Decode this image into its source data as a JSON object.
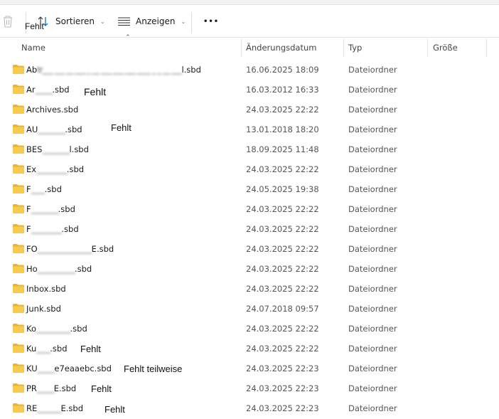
{
  "toolbar": {
    "sort_label": "Sortieren",
    "view_label": "Anzeigen",
    "more_label": "•••"
  },
  "columns": {
    "name": "Name",
    "date": "Änderungsdatum",
    "type": "Typ",
    "size": "Größe"
  },
  "rows": [
    {
      "prefix": "Ab",
      "blur": "tr___ ___ __ ___ _ __ ___ ___ ___ ____ _ _ __ ___",
      "suffix": "l.sbd",
      "date": "16.06.2025 18:09",
      "type": "Dateiordner"
    },
    {
      "prefix": "Ar",
      "blur": "_____",
      "suffix": ".sbd",
      "date": "16.03.2012 16:33",
      "type": "Dateiordner"
    },
    {
      "prefix": "Archives.sbd",
      "blur": "",
      "suffix": "",
      "date": "24.03.2025 22:22",
      "type": "Dateiordner"
    },
    {
      "prefix": "AU",
      "blur": "________",
      "suffix": ".sbd",
      "date": "13.01.2018 18:20",
      "type": "Dateiordner"
    },
    {
      "prefix": "BES",
      "blur": "________",
      "suffix": "l.sbd",
      "date": "18.09.2025 11:48",
      "type": "Dateiordner"
    },
    {
      "prefix": "Ex",
      "blur": "_________",
      "suffix": ".sbd",
      "date": "24.03.2025 22:22",
      "type": "Dateiordner"
    },
    {
      "prefix": "F",
      "blur": "____",
      "suffix": ".sbd",
      "date": "24.05.2025 19:38",
      "type": "Dateiordner"
    },
    {
      "prefix": "F",
      "blur": "________",
      "suffix": ".sbd",
      "date": "24.03.2025 22:22",
      "type": "Dateiordner"
    },
    {
      "prefix": "F",
      "blur": "_________",
      "suffix": ".sbd",
      "date": "24.03.2025 22:22",
      "type": "Dateiordner"
    },
    {
      "prefix": "FO",
      "blur": "________________",
      "suffix": "E.sbd",
      "date": "24.03.2025 22:22",
      "type": "Dateiordner"
    },
    {
      "prefix": "Ho",
      "blur": "___________",
      "suffix": ".sbd",
      "date": "24.03.2025 22:22",
      "type": "Dateiordner"
    },
    {
      "prefix": "Inbox.sbd",
      "blur": "",
      "suffix": "",
      "date": "24.03.2025 22:22",
      "type": "Dateiordner"
    },
    {
      "prefix": "Junk.sbd",
      "blur": "",
      "suffix": "",
      "date": "24.07.2018 09:57",
      "type": "Dateiordner"
    },
    {
      "prefix": "Ko",
      "blur": "__________",
      "suffix": ".sbd",
      "date": "24.03.2025 22:22",
      "type": "Dateiordner"
    },
    {
      "prefix": "Ku",
      "blur": "____",
      "suffix": ".sbd",
      "date": "24.03.2025 22:22",
      "type": "Dateiordner"
    },
    {
      "prefix": "KU",
      "blur": "_____",
      "suffix": "e7eaaebc.sbd",
      "date": "24.03.2025 22:23",
      "type": "Dateiordner"
    },
    {
      "prefix": "PR",
      "blur": "_____",
      "suffix": "E.sbd",
      "date": "24.03.2025 22:23",
      "type": "Dateiordner"
    },
    {
      "prefix": "RE",
      "blur": "_______",
      "suffix": "E.sbd",
      "date": "24.03.2025 22:23",
      "type": "Dateiordner"
    }
  ],
  "annotations": {
    "toolbar": "Fehlt",
    "r2": "Fehlt",
    "r4": "Fehlt",
    "r15": "Fehlt",
    "r16": "Fehlt teilweise",
    "r17": "Fehlt",
    "r18": "Fehlt"
  },
  "colors": {
    "folder": "#f8c94a",
    "accent": "#0067c0"
  }
}
